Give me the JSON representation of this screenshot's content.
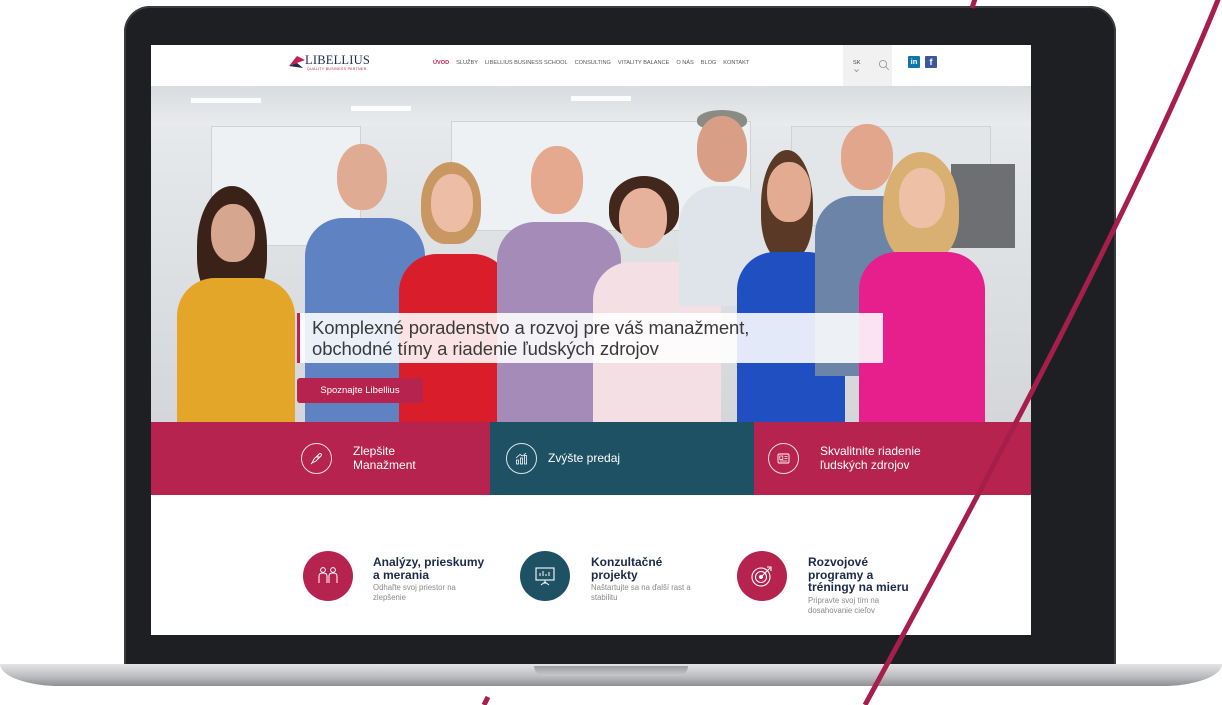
{
  "site": {
    "logo_text": "LIBELLIUS",
    "logo_subtitle": "QUALITY BUSINESS PARTNER"
  },
  "nav": {
    "items": [
      {
        "label": "ÚVOD",
        "active": true
      },
      {
        "label": "SLUŽBY",
        "active": false
      },
      {
        "label": "LIBELLIUS BUSINESS SCHOOL",
        "active": false
      },
      {
        "label": "CONSULTING",
        "active": false
      },
      {
        "label": "VITALITY BALANCE",
        "active": false
      },
      {
        "label": "O NÁS",
        "active": false
      },
      {
        "label": "BLOG",
        "active": false
      },
      {
        "label": "KONTAKT",
        "active": false
      }
    ],
    "language": "SK",
    "social": {
      "linkedin": "in",
      "facebook": "f"
    }
  },
  "hero": {
    "headline_line1": "Komplexné poradenstvo a rozvoj pre váš manažment,",
    "headline_line2": "obchodné tímy a riadenie ľudských zdrojov",
    "cta_label": "Spoznajte Libellius"
  },
  "feature_band": [
    {
      "line1": "Zlepšite",
      "line2": "Manažment",
      "icon": "rocket-icon"
    },
    {
      "line1": "Zvýšte predaj",
      "line2": "",
      "icon": "growth-chart-icon"
    },
    {
      "line1": "Skvalitnite riadenie",
      "line2": "ľudských zdrojov",
      "icon": "id-card-icon"
    }
  ],
  "services": [
    {
      "title_lines": [
        "Analýzy, prieskumy",
        "a merania"
      ],
      "desc_lines": [
        "Odhaľte svoj priestor na",
        "zlepšenie"
      ],
      "icon": "people-analysis-icon"
    },
    {
      "title_lines": [
        "Konzultačné",
        "projekty"
      ],
      "desc_lines": [
        "Naštartujte sa na ďalší rast a",
        "stabilitu"
      ],
      "icon": "presentation-board-icon"
    },
    {
      "title_lines": [
        "Rozvojové",
        "programy a",
        "tréningy na mieru"
      ],
      "desc_lines": [
        "Pripravte svoj tím na",
        "dosahovanie cieľov"
      ],
      "icon": "target-icon"
    }
  ],
  "colors": {
    "accent": "#b7234f",
    "teal": "#1e5163",
    "navy": "#1c2a4a"
  }
}
